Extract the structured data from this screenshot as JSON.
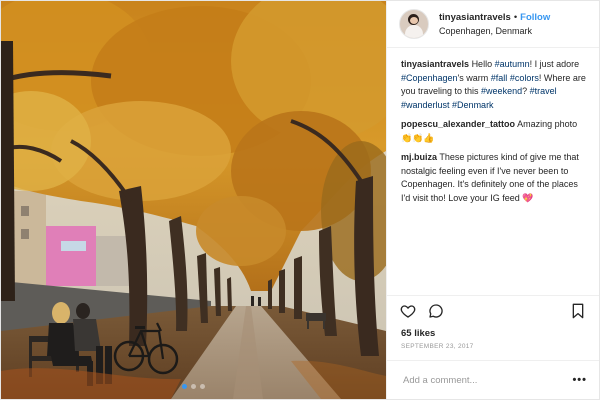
{
  "post": {
    "username": "tinyasiantravels",
    "separator": "•",
    "follow_label": "Follow",
    "location": "Copenhagen, Denmark",
    "carousel": {
      "dot_count": 3,
      "active_index": 0
    }
  },
  "caption": {
    "user": "tinyasiantravels",
    "parts": [
      {
        "text": "Hello ",
        "tag": false
      },
      {
        "text": "#autumn",
        "tag": true
      },
      {
        "text": "! I just adore ",
        "tag": false
      },
      {
        "text": "#Copenhagen",
        "tag": true
      },
      {
        "text": "'s warm ",
        "tag": false
      },
      {
        "text": "#fall",
        "tag": true
      },
      {
        "text": " ",
        "tag": false
      },
      {
        "text": "#colors",
        "tag": true
      },
      {
        "text": "! Where are you traveling to this ",
        "tag": false
      },
      {
        "text": "#weekend",
        "tag": true
      },
      {
        "text": "? ",
        "tag": false
      },
      {
        "text": "#travel",
        "tag": true
      },
      {
        "text": " ",
        "tag": false
      },
      {
        "text": "#wanderlust",
        "tag": true
      },
      {
        "text": " ",
        "tag": false
      },
      {
        "text": "#Denmark",
        "tag": true
      }
    ]
  },
  "comments": [
    {
      "user": "popescu_alexander_tattoo",
      "text": "Amazing photo",
      "emoji": "👏👏👍"
    },
    {
      "user": "mj.buiza",
      "text": "These pictures kind of give me that nostalgic feeling even if I've never been to Copenhagen. It's definitely one of the places I'd visit tho! Love your IG feed",
      "emoji": "💖"
    }
  ],
  "actions": {
    "like_icon": "heart-outline-icon",
    "comment_icon": "comment-bubble-icon",
    "save_icon": "bookmark-icon"
  },
  "likes": "65 likes",
  "date": "SEPTEMBER 23, 2017",
  "add_comment": {
    "placeholder": "Add a comment...",
    "more_icon": "•••"
  },
  "colors": {
    "link": "#3897f0",
    "hashtag": "#003569",
    "muted": "#999999"
  }
}
